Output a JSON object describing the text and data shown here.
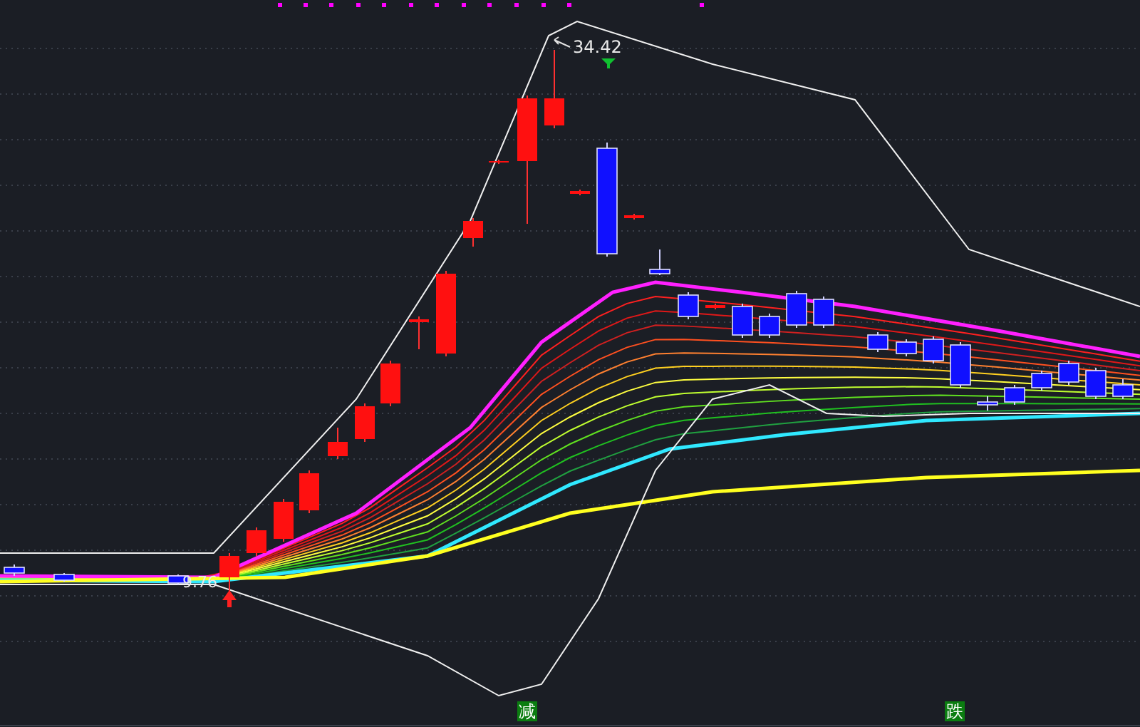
{
  "chart": {
    "high_label": "34.42",
    "low_label": "9.76"
  },
  "signals": [
    {
      "label": "减",
      "color": "#0b7d10"
    },
    {
      "label": "跌",
      "color": "#0b7d10"
    }
  ]
}
